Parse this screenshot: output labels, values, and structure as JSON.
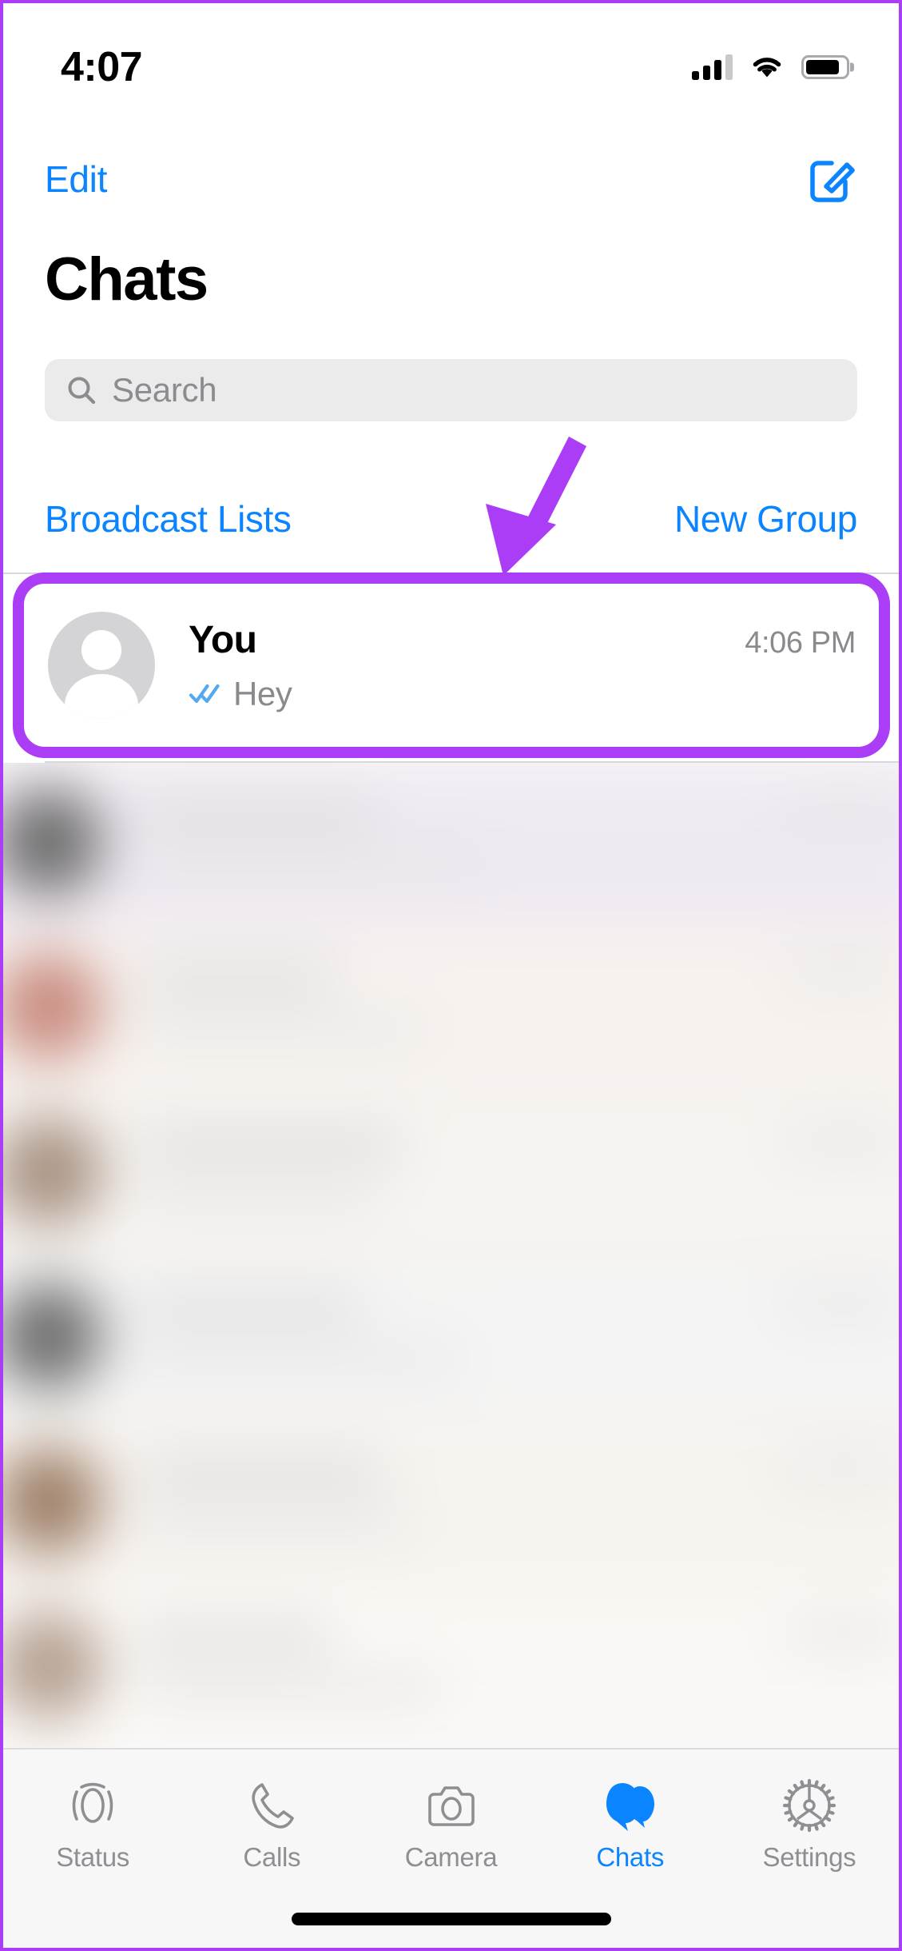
{
  "status_bar": {
    "time": "4:07",
    "signal_icon": "cellular-signal-icon",
    "signal_bars_filled": 3,
    "signal_bars_total": 4,
    "wifi_icon": "wifi-icon",
    "battery_icon": "battery-icon",
    "battery_level_percent": 86
  },
  "nav": {
    "edit_label": "Edit",
    "compose_icon": "compose-icon"
  },
  "header": {
    "title": "Chats"
  },
  "search": {
    "placeholder": "Search",
    "value": "",
    "icon": "search-icon"
  },
  "actions": {
    "broadcast_label": "Broadcast Lists",
    "new_group_label": "New Group"
  },
  "chat_row": {
    "avatar_icon": "default-avatar-icon",
    "name": "You",
    "time": "4:06 PM",
    "read_receipt_icon": "double-check-read-icon",
    "preview": "Hey"
  },
  "annotation": {
    "arrow_icon": "arrow-pointer-icon",
    "color": "#AA3DF5",
    "highlight_color": "#AA3DF5"
  },
  "blurred_rows": [
    {
      "avatar_color": "#6e6e6e",
      "tint": "#efe9f2",
      "name_width": 300,
      "msg_width": 430,
      "has_time": true
    },
    {
      "avatar_color": "#c98c80",
      "tint": "#f7f2ee",
      "name_width": 250,
      "msg_width": 360,
      "has_time": true
    },
    {
      "avatar_color": "#a89282",
      "tint": "#f6f3f0",
      "name_width": 330,
      "msg_width": 300,
      "has_time": true
    },
    {
      "avatar_color": "#6f6f6f",
      "tint": "#f4f4f4",
      "name_width": 280,
      "msg_width": 400,
      "has_time": true
    },
    {
      "avatar_color": "#9f8069",
      "tint": "#f7f3ef",
      "name_width": 310,
      "msg_width": 340,
      "has_time": true
    },
    {
      "avatar_color": "#b5a192",
      "tint": "#faf7f4",
      "name_width": 240,
      "msg_width": 380,
      "has_time": true
    }
  ],
  "tab_bar": {
    "items": [
      {
        "label": "Status",
        "icon": "status-rings-icon",
        "active": false
      },
      {
        "label": "Calls",
        "icon": "phone-icon",
        "active": false
      },
      {
        "label": "Camera",
        "icon": "camera-icon",
        "active": false
      },
      {
        "label": "Chats",
        "icon": "chat-bubbles-icon",
        "active": true
      },
      {
        "label": "Settings",
        "icon": "gear-icon",
        "active": false
      }
    ],
    "active_color": "#0a84ff",
    "inactive_color": "#8e8e93"
  },
  "home_indicator": {
    "icon": "home-indicator"
  }
}
